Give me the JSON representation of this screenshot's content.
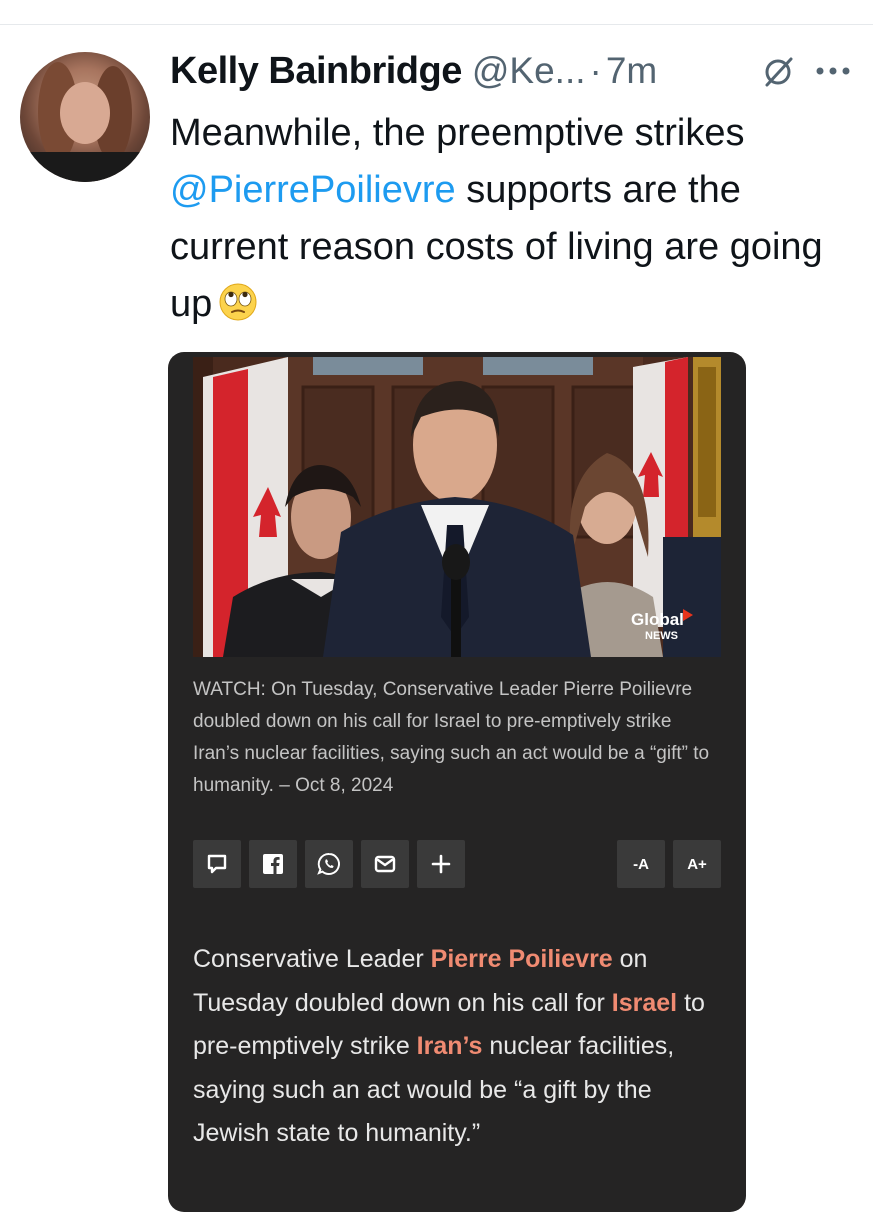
{
  "tweet": {
    "author_name": "Kelly Bainbridge",
    "handle": "@Ke...",
    "separator": "·",
    "time": "7m",
    "text_before_mention": "Meanwhile, the preemptive strikes ",
    "mention": "@PierrePoilievre",
    "text_after_mention": " supports are the current reason costs of living are going up",
    "emoji": "face-with-rolling-eyes"
  },
  "card": {
    "media": {
      "watermark_line1": "Global",
      "watermark_line2": "NEWS"
    },
    "caption": "WATCH: On Tuesday, Conservative Leader Pierre Poilievre doubled down on his call for Israel to pre-emptively strike Iran’s nuclear facilities, saying such an act would be a “gift” to humanity. – Oct 8, 2024",
    "toolbar": {
      "share_buttons": [
        "comment-icon",
        "facebook-icon",
        "whatsapp-icon",
        "email-icon",
        "plus-icon"
      ],
      "decrease_text_label": "-A",
      "increase_text_label": "A+"
    },
    "article": {
      "p1": "Conservative Leader ",
      "link1": "Pierre Poilievre",
      "p2": " on Tuesday doubled down on his call for ",
      "link2": "Israel",
      "p3": " to pre-emptively strike ",
      "link3": "Iran’s",
      "p4": " nuclear facilities, saying such an act would be “a gift by the Jewish state to humanity.”"
    }
  },
  "colors": {
    "mention": "#1d9bf0",
    "card_background": "#252424",
    "article_link": "#f08b72",
    "muted_text": "#536471"
  }
}
